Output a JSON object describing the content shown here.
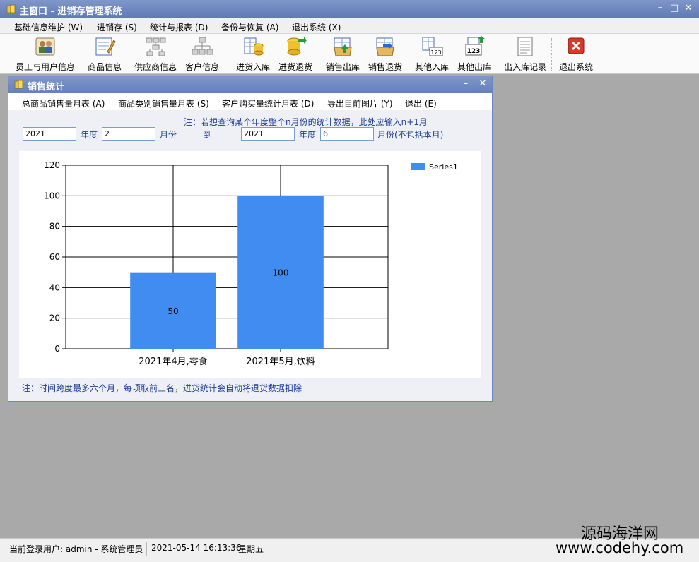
{
  "main_window": {
    "title": "主窗口 - 进销存管理系统"
  },
  "menubar": {
    "items": [
      "基础信息维护 (W)",
      "进销存 (S)",
      "统计与报表 (D)",
      "备份与恢复 (A)",
      "退出系统 (X)"
    ]
  },
  "toolbar": {
    "buttons": [
      "员工与用户信息",
      "商品信息",
      "供应商信息",
      "客户信息",
      "进货入库",
      "进货退货",
      "销售出库",
      "销售退货",
      "其他入库",
      "其他出库",
      "出入库记录",
      "退出系统"
    ]
  },
  "child_window": {
    "title": "销售统计",
    "menu": [
      "总商品销售量月表 (A)",
      "商品类别销售量月表 (S)",
      "客户购买量统计月表 (D)",
      "导出目前图片 (Y)",
      "退出 (E)"
    ],
    "note_top": "注：若想查询某个年度整个n月份的统计数据，此处应输入n+1月",
    "note_bottom": "注：时间跨度最多六个月，每项取前三名，进货统计会自动将退货数据扣除",
    "fields": {
      "start_year": "2021",
      "start_month": "2",
      "end_year": "2021",
      "end_month": "6",
      "year_label": "年度",
      "month_label": "月份",
      "to_label": "到",
      "month_label_end": "月份(不包括本月)"
    }
  },
  "chart_data": {
    "type": "bar",
    "categories": [
      "2021年4月,零食",
      "2021年5月,饮料"
    ],
    "series": [
      {
        "name": "Series1",
        "values": [
          50,
          100
        ]
      }
    ],
    "ylim": [
      0,
      120
    ],
    "yticks": [
      0,
      20,
      40,
      60,
      80,
      100,
      120
    ],
    "grid": true,
    "legend": "top-right",
    "data_labels": [
      "50",
      "100"
    ],
    "bar_color": "#418cf0"
  },
  "statusbar": {
    "user": "当前登录用户: admin - 系统管理员",
    "datetime": "2021-05-14 16:13:36",
    "weekday": "星期五"
  },
  "watermark": {
    "site_name": "源码海洋网",
    "site_url": "www.codehy.com"
  },
  "colors": {
    "titlebar": "#6b84bd",
    "label_blue": "#1f3e93"
  }
}
